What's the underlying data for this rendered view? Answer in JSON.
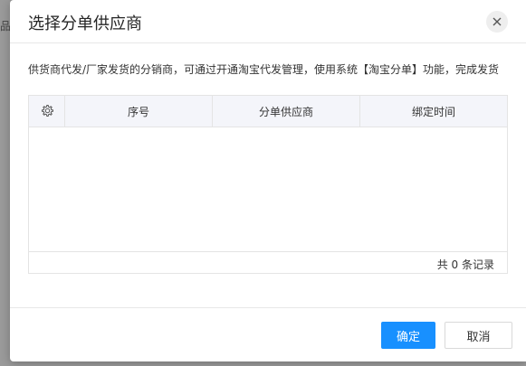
{
  "background": {
    "partial_text": "品"
  },
  "dialog": {
    "title": "选择分单供应商",
    "description": "供货商代发/厂家发货的分销商，可通过开通淘宝代发管理，使用系统【淘宝分单】功能，完成发货"
  },
  "table": {
    "settings_icon": "gear-icon",
    "columns": [
      "序号",
      "分单供应商",
      "绑定时间"
    ],
    "rows": [],
    "footer_total": "共 0 条记录"
  },
  "footer": {
    "confirm_label": "确定",
    "cancel_label": "取消"
  },
  "colors": {
    "primary": "#1890ff",
    "header_bg": "#f4f5fa"
  }
}
